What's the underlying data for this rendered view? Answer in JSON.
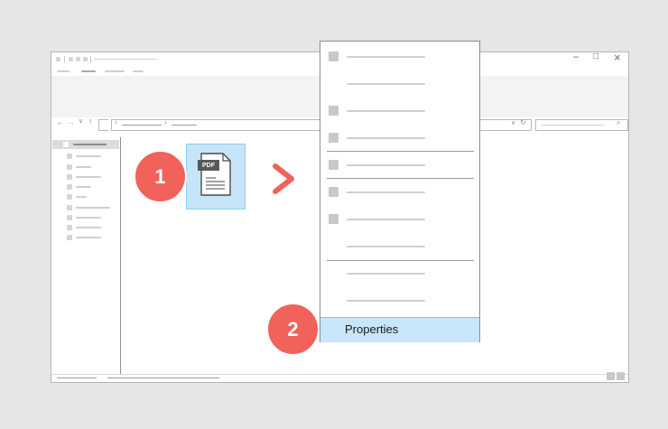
{
  "file": {
    "type_label": "PDF"
  },
  "steps": {
    "one": "1",
    "two": "2"
  },
  "context_menu": {
    "properties_label": "Properties"
  },
  "window_controls": {
    "minimize": "–",
    "maximize": "□",
    "close": "×"
  },
  "colors": {
    "badge": "#f1625a",
    "selection": "#c6e5f9",
    "menu_highlight": "#c7e6fa"
  }
}
